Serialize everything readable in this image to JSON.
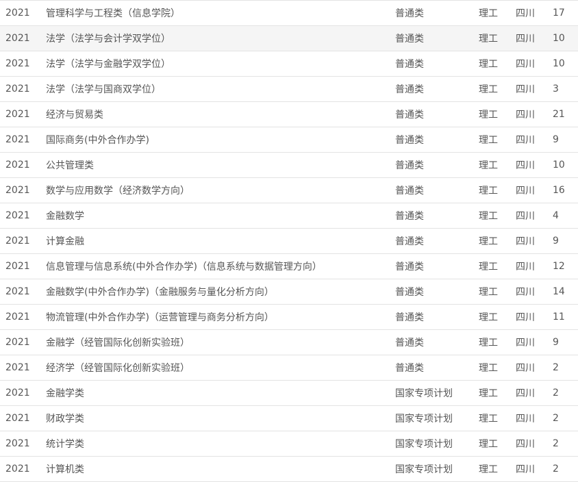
{
  "rows": [
    {
      "year": "2021",
      "major": "管理科学与工程类（信息学院）",
      "type": "普通类",
      "subject": "理工",
      "province": "四川",
      "count": "17"
    },
    {
      "year": "2021",
      "major": "法学（法学与会计学双学位）",
      "type": "普通类",
      "subject": "理工",
      "province": "四川",
      "count": "10",
      "highlighted": true
    },
    {
      "year": "2021",
      "major": "法学（法学与金融学双学位）",
      "type": "普通类",
      "subject": "理工",
      "province": "四川",
      "count": "10"
    },
    {
      "year": "2021",
      "major": "法学（法学与国商双学位）",
      "type": "普通类",
      "subject": "理工",
      "province": "四川",
      "count": "3"
    },
    {
      "year": "2021",
      "major": "经济与贸易类",
      "type": "普通类",
      "subject": "理工",
      "province": "四川",
      "count": "21"
    },
    {
      "year": "2021",
      "major": "国际商务(中外合作办学)",
      "type": "普通类",
      "subject": "理工",
      "province": "四川",
      "count": "9"
    },
    {
      "year": "2021",
      "major": "公共管理类",
      "type": "普通类",
      "subject": "理工",
      "province": "四川",
      "count": "10"
    },
    {
      "year": "2021",
      "major": "数学与应用数学（经济数学方向）",
      "type": "普通类",
      "subject": "理工",
      "province": "四川",
      "count": "16"
    },
    {
      "year": "2021",
      "major": "金融数学",
      "type": "普通类",
      "subject": "理工",
      "province": "四川",
      "count": "4"
    },
    {
      "year": "2021",
      "major": "计算金融",
      "type": "普通类",
      "subject": "理工",
      "province": "四川",
      "count": "9"
    },
    {
      "year": "2021",
      "major": "信息管理与信息系统(中外合作办学)（信息系统与数据管理方向）",
      "type": "普通类",
      "subject": "理工",
      "province": "四川",
      "count": "12"
    },
    {
      "year": "2021",
      "major": "金融数学(中外合作办学)（金融服务与量化分析方向）",
      "type": "普通类",
      "subject": "理工",
      "province": "四川",
      "count": "14"
    },
    {
      "year": "2021",
      "major": "物流管理(中外合作办学)（运营管理与商务分析方向）",
      "type": "普通类",
      "subject": "理工",
      "province": "四川",
      "count": "11"
    },
    {
      "year": "2021",
      "major": "金融学（经管国际化创新实验班）",
      "type": "普通类",
      "subject": "理工",
      "province": "四川",
      "count": "9"
    },
    {
      "year": "2021",
      "major": "经济学（经管国际化创新实验班）",
      "type": "普通类",
      "subject": "理工",
      "province": "四川",
      "count": "2"
    },
    {
      "year": "2021",
      "major": "金融学类",
      "type": "国家专项计划",
      "subject": "理工",
      "province": "四川",
      "count": "2"
    },
    {
      "year": "2021",
      "major": "财政学类",
      "type": "国家专项计划",
      "subject": "理工",
      "province": "四川",
      "count": "2"
    },
    {
      "year": "2021",
      "major": "统计学类",
      "type": "国家专项计划",
      "subject": "理工",
      "province": "四川",
      "count": "2"
    },
    {
      "year": "2021",
      "major": "计算机类",
      "type": "国家专项计划",
      "subject": "理工",
      "province": "四川",
      "count": "2"
    }
  ]
}
